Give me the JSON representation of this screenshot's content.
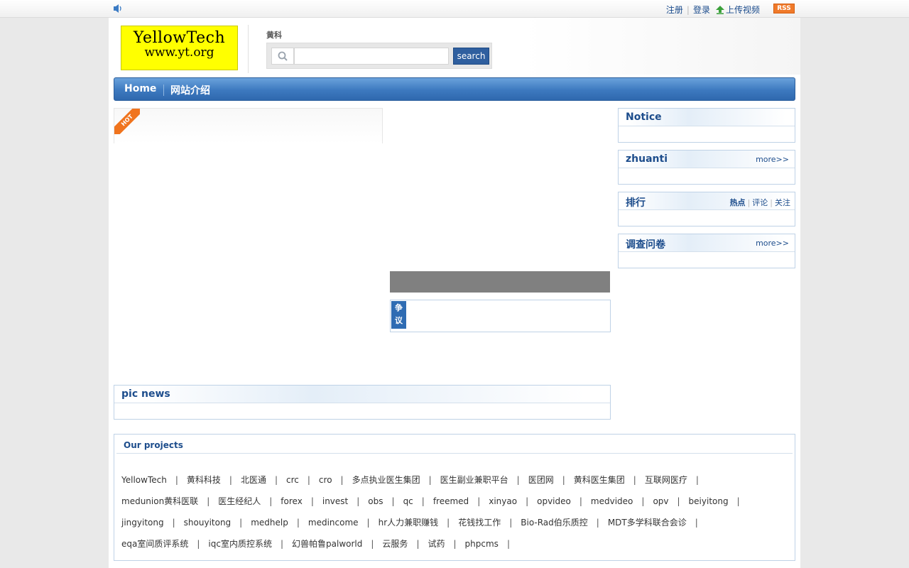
{
  "topbar": {
    "register": "注册",
    "login": "登录",
    "upload": "上传视频",
    "rss": "RSS"
  },
  "header": {
    "logo_line1": "YellowTech",
    "logo_line2": "www.yt.org",
    "search_label": "黄科",
    "search_value": "",
    "search_button": "search"
  },
  "nav": {
    "items": [
      "Home",
      "网站介绍"
    ]
  },
  "left": {
    "hot_badge": "HOT",
    "dispute_tag": "争议"
  },
  "pic_news": {
    "title": "pic news"
  },
  "sidebar": {
    "notice": {
      "title": "Notice"
    },
    "zhuanti": {
      "title": "zhuanti",
      "more": "more>>"
    },
    "ranking": {
      "title": "排行",
      "tabs": [
        "热点",
        "评论",
        "关注"
      ]
    },
    "survey": {
      "title": "调查问卷",
      "more": "more>>"
    }
  },
  "projects": {
    "title": "Our projects",
    "lines": [
      [
        "YellowTech",
        "黄科科技",
        "北医通",
        "crc",
        "cro",
        "多点执业医生集团",
        "医生副业兼职平台",
        "医团网",
        "黄科医生集团",
        "互联网医疗"
      ],
      [
        "medunion黄科医联",
        "医生经纪人",
        "forex",
        "invest",
        "obs",
        "qc",
        "freemed",
        "xinyao",
        "opvideo",
        "medvideo",
        "opv",
        "beiyitong"
      ],
      [
        "jingyitong",
        "shouyitong",
        "medhelp",
        "medincome",
        "hr人力兼职赚钱",
        "花钱找工作",
        "Bio-Rad伯乐质控",
        "MDT多学科联合会诊"
      ],
      [
        "eqa室间质评系统",
        "iqc室内质控系统",
        "幻兽帕鲁palworld",
        "云服务",
        "试药",
        "phpcms"
      ]
    ]
  },
  "colors": {
    "nav_blue": "#3d79bf",
    "title_blue": "#1d4d8c",
    "logo_yellow": "#ffff00",
    "rss_orange": "#f07a2a"
  }
}
